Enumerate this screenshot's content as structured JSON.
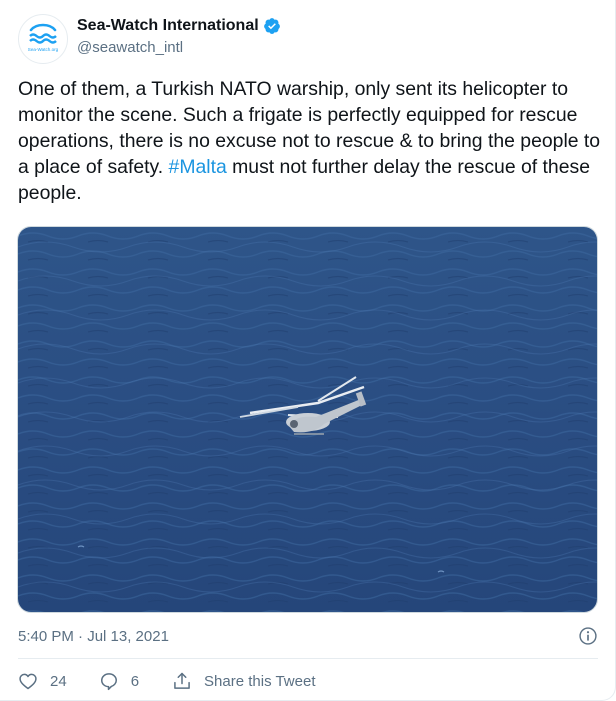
{
  "author": {
    "display_name": "Sea-Watch International",
    "handle": "@seawatch_intl",
    "avatar_text": "Sea-Watch.org"
  },
  "tweet": {
    "text_before": "One of them, a Turkish NATO warship, only sent its helicopter to monitor the scene. Such a frigate is perfectly equipped for rescue operations, there is no excuse not to rescue & to bring the people to a place of safety. ",
    "hashtag": "#Malta",
    "text_after": " must not further delay the rescue of these people.",
    "timestamp": "5:40 PM · Jul 13, 2021"
  },
  "actions": {
    "likes": "24",
    "replies": "6",
    "share_label": "Share this Tweet"
  },
  "colors": {
    "accent": "#1da1f2",
    "hashtag": "#1b95e0",
    "secondary_text": "#5b7083",
    "sea": "#2b4f86"
  },
  "icons": {
    "verified": "verified-badge-icon",
    "info": "info-icon",
    "like": "heart-icon",
    "reply": "reply-bubble-icon",
    "share": "share-icon"
  }
}
